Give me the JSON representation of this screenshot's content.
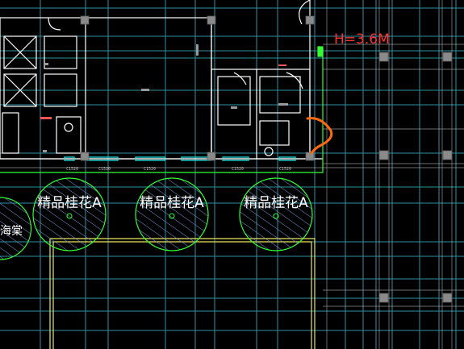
{
  "colors": {
    "background": "#000000",
    "grid": "#3aa8c0",
    "wall": "#ffffff",
    "green": "#33ff33",
    "yellow": "#e8e860",
    "orange": "#ff6a10",
    "red": "#ff3333",
    "column": "#808080"
  },
  "annotation": {
    "height_label": "H=3.6M"
  },
  "trees": [
    {
      "label": "精品桂花A"
    },
    {
      "label": "精品桂花A"
    },
    {
      "label": "精品桂花A"
    }
  ],
  "edge_label": "海棠",
  "window_tags": [
    "C1520",
    "C1520",
    "C1520",
    "C1520",
    "C1520"
  ]
}
